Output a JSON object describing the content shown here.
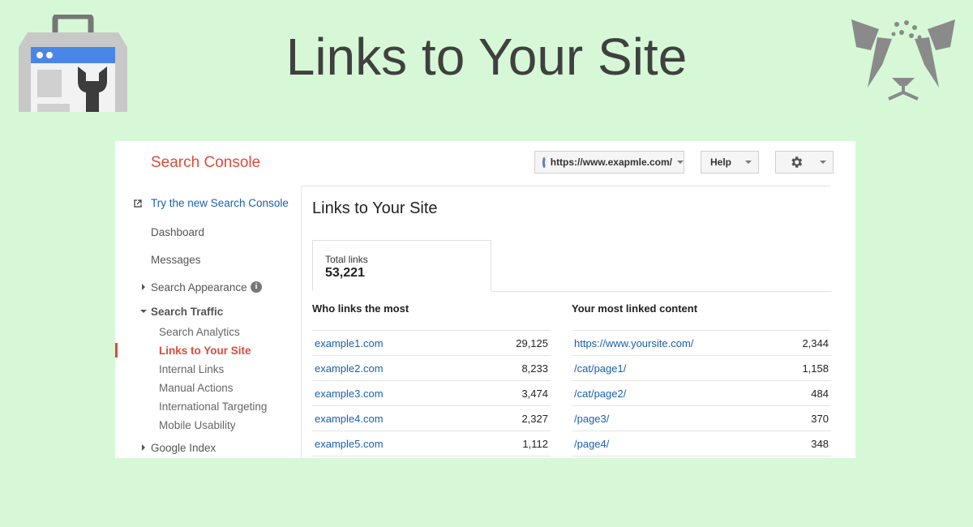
{
  "hero": {
    "title": "Links to Your Site"
  },
  "app": {
    "brand": "Search Console"
  },
  "header": {
    "site_url": "https://www.exapmle.com/",
    "help_label": "Help"
  },
  "sidebar": {
    "new_console_link": "Try the new Search Console",
    "dashboard": "Dashboard",
    "messages": "Messages",
    "search_appearance": "Search Appearance",
    "search_traffic": "Search Traffic",
    "search_traffic_items": [
      "Search Analytics",
      "Links to Your Site",
      "Internal Links",
      "Manual Actions",
      "International Targeting",
      "Mobile Usability"
    ],
    "google_index": "Google Index"
  },
  "main": {
    "title": "Links to Your Site",
    "total_links_label": "Total links",
    "total_links_value": "53,221",
    "who_links_heading": "Who links the most",
    "most_linked_heading": "Your most linked content",
    "who_links": [
      {
        "domain": "example1.com",
        "links": "29,125"
      },
      {
        "domain": "example2.com",
        "links": "8,233"
      },
      {
        "domain": "example3.com",
        "links": "3,474"
      },
      {
        "domain": "example4.com",
        "links": "2,327"
      },
      {
        "domain": "example5.com",
        "links": "1,112"
      }
    ],
    "most_linked": [
      {
        "page": "https://www.yoursite.com/",
        "links": "2,344"
      },
      {
        "page": "/cat/page1/",
        "links": "1,158"
      },
      {
        "page": "/cat/page2/",
        "links": "484"
      },
      {
        "page": "/page3/",
        "links": "370"
      },
      {
        "page": "/page4/",
        "links": "348"
      }
    ]
  },
  "colors": {
    "background": "#d6f8d6",
    "brand_red": "#dd4b39",
    "link_blue": "#1a5fb4"
  },
  "icons": [
    "search-console-toolbox-logo",
    "cat-face-logo",
    "globe-icon",
    "settings-gear-icon",
    "info-icon",
    "external-link-icon"
  ]
}
